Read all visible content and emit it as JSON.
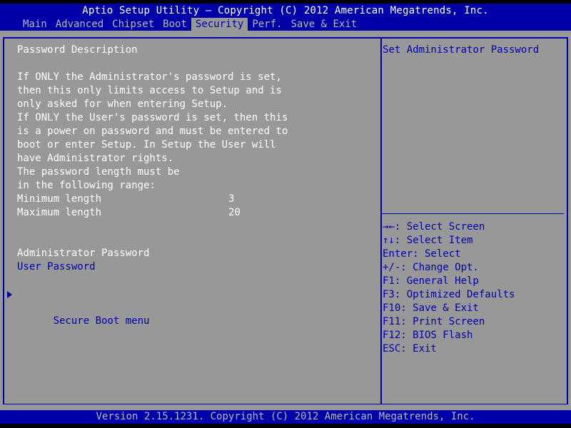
{
  "header": {
    "title": "Aptio Setup Utility – Copyright (C) 2012 American Megatrends, Inc.",
    "tabs": [
      {
        "label": "Main",
        "active": false
      },
      {
        "label": "Advanced",
        "active": false
      },
      {
        "label": "Chipset",
        "active": false
      },
      {
        "label": "Boot",
        "active": false
      },
      {
        "label": "Security",
        "active": true
      },
      {
        "label": "Perf.",
        "active": false
      },
      {
        "label": "Save & Exit",
        "active": false
      }
    ]
  },
  "main": {
    "section_title": "Password Description",
    "description": [
      "If ONLY the Administrator's password is set,",
      "then this only limits access to Setup and is",
      "only asked for when entering Setup.",
      "If ONLY the User's password is set, then this",
      "is a power on password and must be entered to",
      "boot or enter Setup. In Setup the User will",
      "have Administrator rights.",
      "The password length must be",
      "in the following range:"
    ],
    "min_length": {
      "label": "Minimum length",
      "value": "3"
    },
    "max_length": {
      "label": "Maximum length",
      "value": "20"
    },
    "items": [
      {
        "label": "Administrator Password",
        "selected": true
      },
      {
        "label": "User Password",
        "selected": false
      }
    ],
    "submenu": {
      "label": "Secure Boot menu"
    }
  },
  "help": {
    "text": "Set Administrator Password"
  },
  "keys": [
    "→←: Select Screen",
    "↑↓: Select Item",
    "Enter: Select",
    "+/-: Change Opt.",
    "F1: General Help",
    "F3: Optimized Defaults",
    "F10: Save & Exit",
    "F11: Print Screen",
    "F12: BIOS Flash",
    "ESC: Exit"
  ],
  "footer": {
    "text": "Version 2.15.1231. Copyright (C) 2012 American Megatrends, Inc."
  },
  "colors": {
    "bios_blue": "#0000a8",
    "body_gray": "#989898",
    "selected_text": "#ffffff",
    "inactive_tab": "#b8b8b8"
  }
}
